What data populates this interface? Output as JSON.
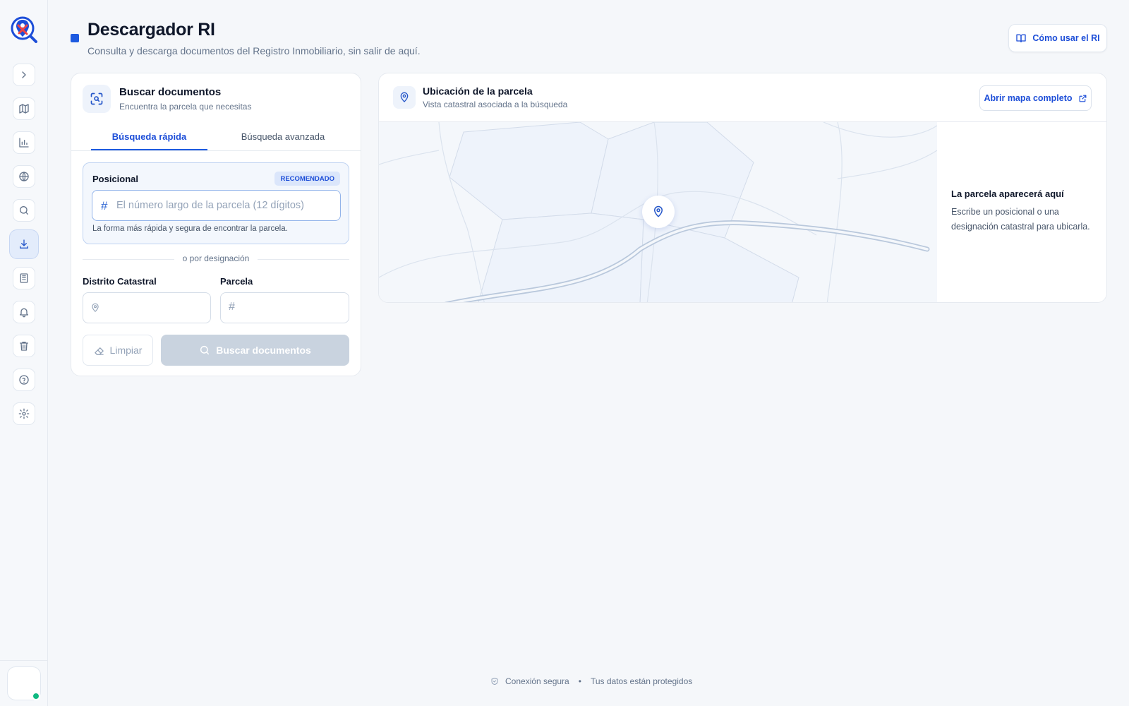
{
  "sidebar": {
    "items": [
      {
        "icon": "chevron-right-icon"
      },
      {
        "icon": "map-icon"
      },
      {
        "icon": "bar-chart-icon"
      },
      {
        "icon": "globe-icon"
      },
      {
        "icon": "search-icon"
      },
      {
        "icon": "download-icon",
        "active": true
      },
      {
        "icon": "building-icon"
      },
      {
        "icon": "bell-icon"
      },
      {
        "icon": "trash-icon"
      },
      {
        "icon": "help-circle-icon"
      },
      {
        "icon": "settings-icon"
      }
    ]
  },
  "header": {
    "title": "Descargador RI",
    "subtitle": "Consulta y descarga documentos del Registro Inmobiliario, sin salir de aquí.",
    "help_button": "Cómo usar el RI"
  },
  "search": {
    "title": "Buscar documentos",
    "subtitle": "Encuentra la parcela que necesitas",
    "tabs": [
      {
        "label": "Búsqueda rápida",
        "active": true
      },
      {
        "label": "Búsqueda avanzada",
        "active": false
      }
    ],
    "posicional": {
      "label": "Posicional",
      "badge": "RECOMENDADO",
      "placeholder": "El número largo de la parcela (12 dígitos)",
      "value": "",
      "hint": "La forma más rápida y segura de encontrar la parcela."
    },
    "divider": "o por designación",
    "distrito": {
      "label": "Distrito Catastral",
      "value": ""
    },
    "parcela": {
      "label": "Parcela",
      "value": ""
    },
    "clear_button": "Limpiar",
    "search_button": "Buscar documentos"
  },
  "map": {
    "title": "Ubicación de la parcela",
    "subtitle": "Vista catastral asociada a la búsqueda",
    "open_button": "Abrir mapa completo",
    "empty_title": "La parcela aparecerá aquí",
    "empty_text": "Escribe un posicional o una designación catastral para ubicarla."
  },
  "footer": {
    "secure": "Conexión segura",
    "separator": "•",
    "protected": "Tus datos están protegidos"
  },
  "colors": {
    "accent": "#1d5ae0",
    "link": "#1d4ed8",
    "status_online": "#10b981",
    "disabled_button": "#c9d3df"
  }
}
